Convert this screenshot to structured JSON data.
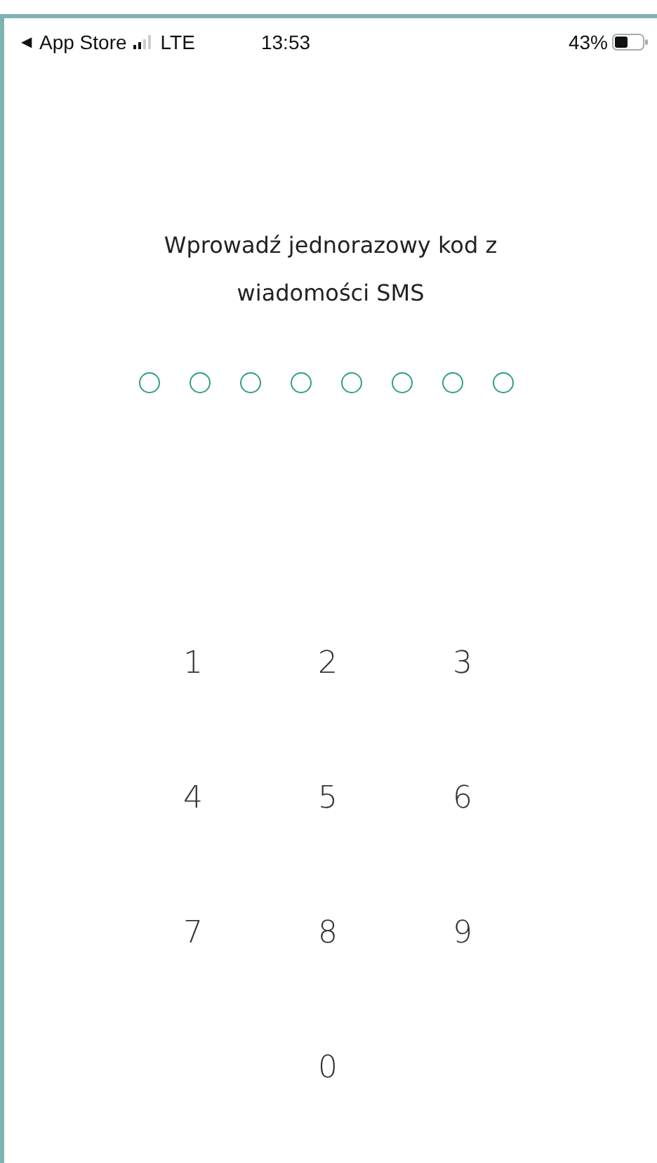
{
  "status_bar": {
    "back_arrow": "◀",
    "back_label": "App Store",
    "network": "LTE",
    "time": "13:53",
    "battery": "43%"
  },
  "prompt": "Wprowadź jednorazowy kod z wiadomości SMS",
  "code_dots": [
    {
      "filled": false
    },
    {
      "filled": false
    },
    {
      "filled": false
    },
    {
      "filled": false
    },
    {
      "filled": false
    },
    {
      "filled": false
    },
    {
      "filled": false
    },
    {
      "filled": false
    }
  ],
  "keypad": [
    {
      "label": "1",
      "kind": "digit"
    },
    {
      "label": "2",
      "kind": "digit"
    },
    {
      "label": "3",
      "kind": "digit"
    },
    {
      "label": "4",
      "kind": "digit"
    },
    {
      "label": "5",
      "kind": "digit"
    },
    {
      "label": "6",
      "kind": "digit"
    },
    {
      "label": "7",
      "kind": "digit"
    },
    {
      "label": "8",
      "kind": "digit"
    },
    {
      "label": "9",
      "kind": "digit"
    },
    {
      "kind": "empty"
    },
    {
      "label": "0",
      "kind": "digit"
    },
    {
      "kind": "empty"
    }
  ]
}
